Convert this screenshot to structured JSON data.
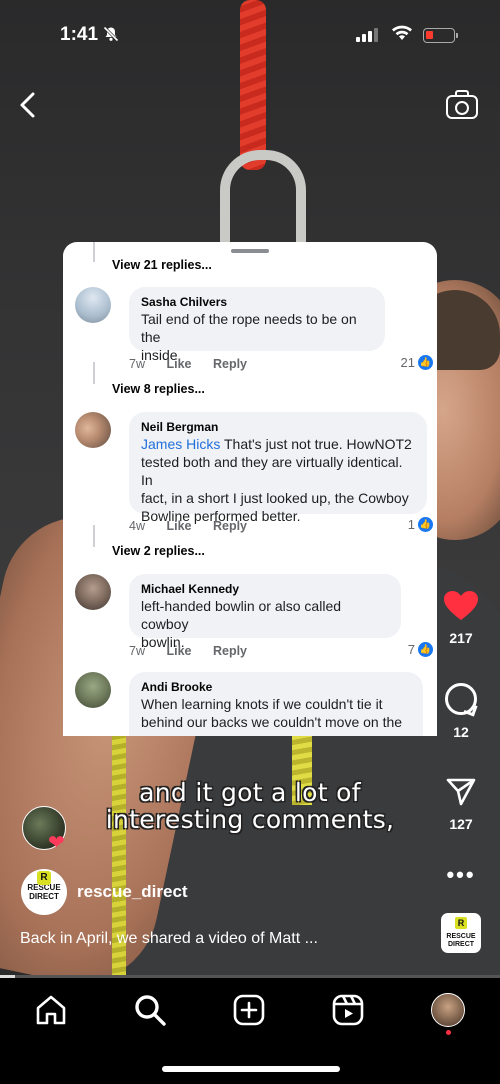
{
  "status_bar": {
    "time": "1:41"
  },
  "comments_card": {
    "view_replies_1": "View 21 replies...",
    "view_replies_2": "View 8 replies...",
    "view_replies_3": "View 2 replies...",
    "comments": [
      {
        "name": "Sasha Chilvers",
        "text_line1": "Tail end of the rope needs to be on the",
        "text_line2": "inside",
        "age": "7w",
        "like": "Like",
        "reply": "Reply",
        "reactions": "21"
      },
      {
        "name": "Neil Bergman",
        "mention": "James Hicks",
        "text_line1": " That's just not true. HowNOT2",
        "text_line2": "tested both and they are virtually identical. In",
        "text_line3": "fact, in a short I just looked up, the Cowboy",
        "text_line4": "Bowline performed better.",
        "age": "4w",
        "like": "Like",
        "reply": "Reply",
        "reactions": "1"
      },
      {
        "name": "Michael Kennedy",
        "text_line1": "left-handed bowlin or also called cowboy",
        "text_line2": "bowlin.",
        "age": "7w",
        "like": "Like",
        "reply": "Reply",
        "reactions": "7"
      },
      {
        "name": "Andi Brooke",
        "text_line1": "When learning knots if we couldn't tie it",
        "text_line2": "behind our backs we couldn't move on the"
      }
    ]
  },
  "captions": {
    "line1": "and it got a lot of",
    "line2": "interesting comments,"
  },
  "rail": {
    "likes": "217",
    "comments": "12",
    "shares": "127",
    "more": "•••"
  },
  "post": {
    "account": "rescue_direct",
    "logo_text_1": "RESCUE",
    "logo_text_2": "DIRECT",
    "logo_mark": "R",
    "description": "Back in April, we shared a video of Matt ...",
    "progress": 0.03
  },
  "colors": {
    "like_red": "#ff3040",
    "mention_blue": "#216fdb",
    "logo_yellow": "#d8e021"
  }
}
